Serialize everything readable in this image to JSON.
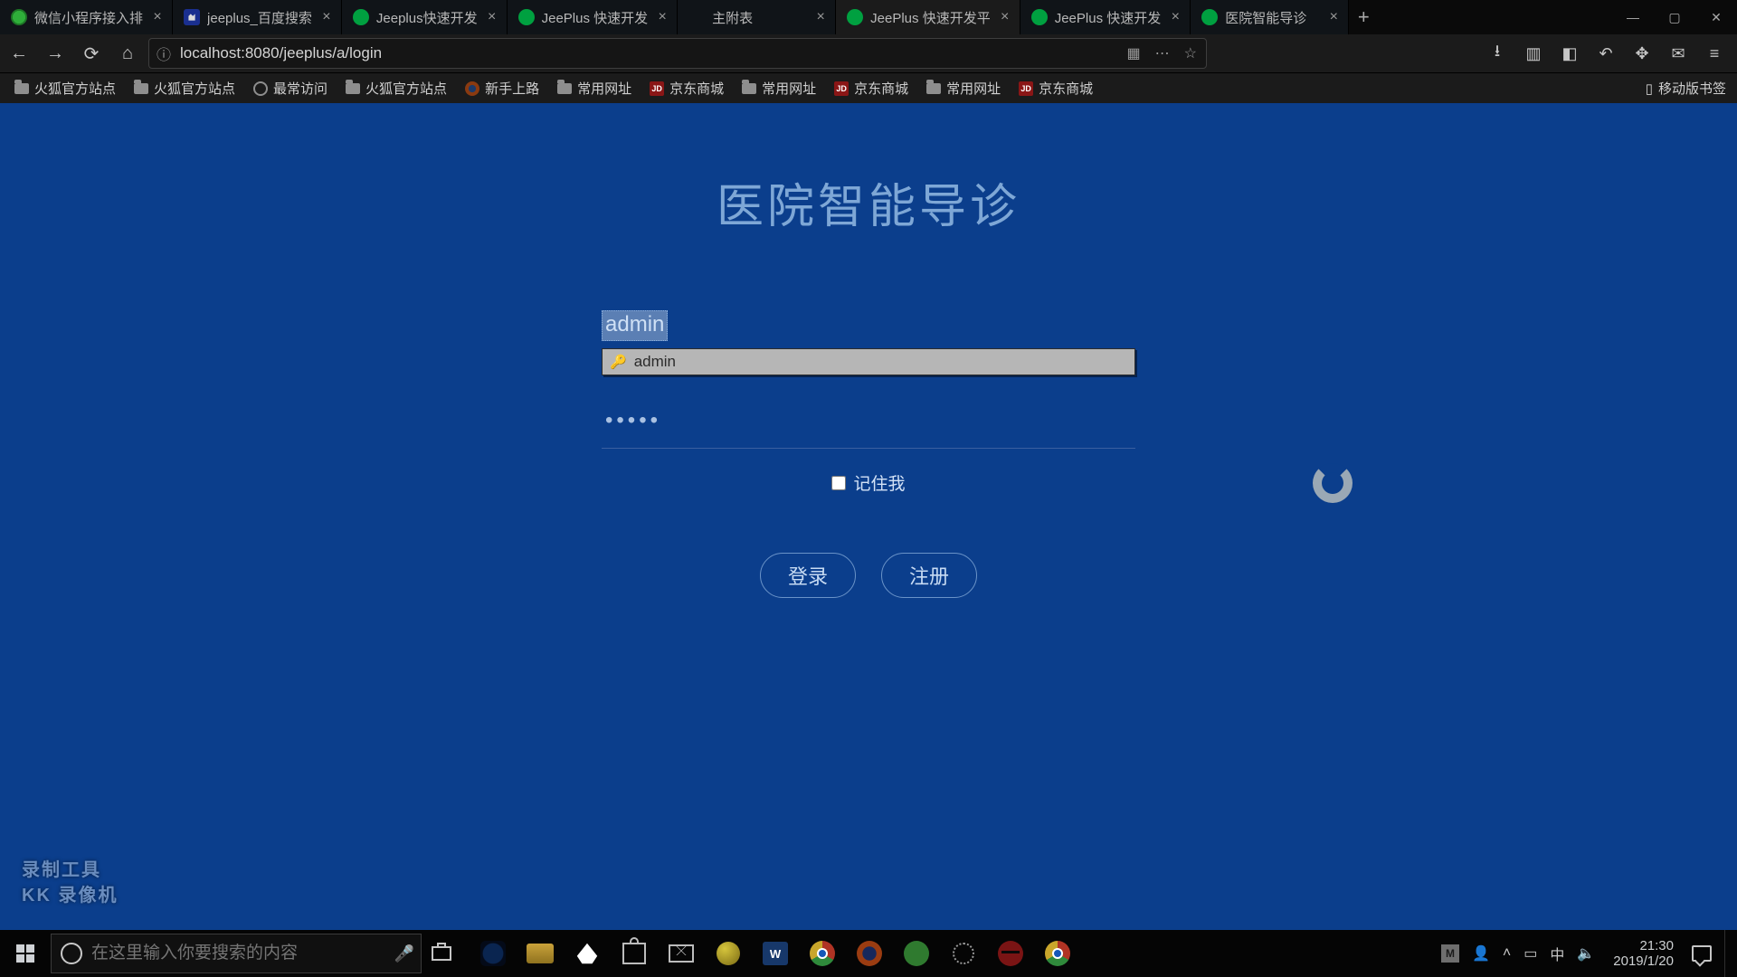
{
  "browser": {
    "tabs": [
      {
        "label": "微信小程序接入排",
        "favicon": "green"
      },
      {
        "label": "jeeplus_百度搜索",
        "favicon": "baidu"
      },
      {
        "label": "Jeeplus快速开发",
        "favicon": "jee"
      },
      {
        "label": "JeePlus 快速开发",
        "favicon": "jee"
      },
      {
        "label": "主附表",
        "favicon": "none"
      },
      {
        "label": "JeePlus 快速开发平",
        "favicon": "jee",
        "active": true
      },
      {
        "label": "JeePlus 快速开发",
        "favicon": "jee"
      },
      {
        "label": "医院智能导诊",
        "favicon": "jee"
      }
    ],
    "url": "localhost:8080/jeeplus/a/login",
    "bookmarks": [
      {
        "label": "火狐官方站点",
        "kind": "folder"
      },
      {
        "label": "火狐官方站点",
        "kind": "folder"
      },
      {
        "label": "最常访问",
        "kind": "gear"
      },
      {
        "label": "火狐官方站点",
        "kind": "folder"
      },
      {
        "label": "新手上路",
        "kind": "ff"
      },
      {
        "label": "常用网址",
        "kind": "folder"
      },
      {
        "label": "京东商城",
        "kind": "jd"
      },
      {
        "label": "常用网址",
        "kind": "folder"
      },
      {
        "label": "京东商城",
        "kind": "jd"
      },
      {
        "label": "常用网址",
        "kind": "folder"
      },
      {
        "label": "京东商城",
        "kind": "jd"
      }
    ],
    "mobile_bookmarks_label": "移动版书签"
  },
  "login": {
    "title": "医院智能导诊",
    "username_value": "admin",
    "autofill_suggestion": "admin",
    "password_mask": "•••••",
    "remember_label": "记住我",
    "login_btn": "登录",
    "register_btn": "注册"
  },
  "watermark": {
    "line1": "录制工具",
    "line2": "KK 录像机"
  },
  "taskbar": {
    "search_placeholder": "在这里输入你要搜索的内容",
    "time": "21:30",
    "date": "2019/1/20",
    "m_badge": "M"
  }
}
